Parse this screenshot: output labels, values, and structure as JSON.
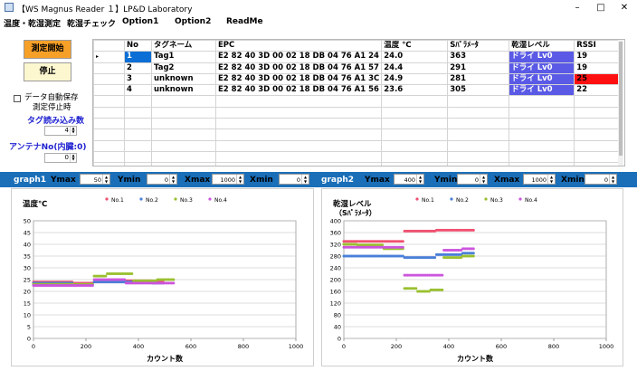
{
  "window": {
    "title": "【WS Magnus Reader １】LP&D Laboratory",
    "minimize": "–",
    "maximize": "□",
    "close": "✕"
  },
  "menu": [
    "温度・乾湿測定",
    "乾湿チェック",
    "Option1",
    "Option2",
    "ReadMe"
  ],
  "left": {
    "start_button": "測定開始",
    "stop_button": "停止",
    "auto_save_label": "データ自動保存",
    "auto_save_sub": "測定停止時",
    "tag_read_label": "タグ読み込み数",
    "tag_read_value": "4",
    "antenna_label": "アンテナNo(内臓:0)",
    "antenna_value": "0"
  },
  "table": {
    "headers": [
      "No",
      "タグネーム",
      "EPC",
      "温度 ℃",
      "Sﾊﾟﾗﾒｰﾀ",
      "乾湿レベル",
      "RSSI"
    ],
    "rows": [
      [
        "1",
        "Tag1",
        "E2 82 40 3D 00 02 18 DB 04 76 A1 24",
        "24.0",
        "363",
        "ドライ Lv0",
        "19"
      ],
      [
        "2",
        "Tag2",
        "E2 82 40 3D 00 02 18 DB 04 76 A1 57",
        "24.4",
        "291",
        "ドライ Lv0",
        "19"
      ],
      [
        "3",
        "unknown",
        "E2 82 40 3D 00 02 18 DB 04 76 A1 3C",
        "24.9",
        "281",
        "ドライ Lv0",
        "25"
      ],
      [
        "4",
        "unknown",
        "E2 82 40 3D 00 02 18 DB 04 76 A1 56",
        "23.6",
        "305",
        "ドライ Lv0",
        "22"
      ]
    ],
    "red_rssi_row": 2,
    "selected_no_row": 0,
    "empty_rows": 7
  },
  "graph1": {
    "label": "graph1",
    "ymax_label": "Ymax",
    "ymax": "50",
    "ymin_label": "Ymin",
    "ymin": "0",
    "xmax_label": "Xmax",
    "xmax": "1000",
    "xmin_label": "Xmin",
    "xmin": "0"
  },
  "graph2": {
    "label": "graph2",
    "ymax_label": "Ymax",
    "ymax": "400",
    "ymin_label": "Ymin",
    "ymin": "0",
    "xmax_label": "Xmax",
    "xmax": "1000",
    "xmin_label": "Xmin",
    "xmin": "0"
  },
  "chart_data": [
    {
      "type": "scatter",
      "title": "温度℃",
      "xlabel": "カウント数",
      "ylabel": "",
      "xlim": [
        0,
        1000
      ],
      "ylim": [
        0,
        50
      ],
      "xticks": [
        0,
        200,
        400,
        600,
        800,
        1000
      ],
      "yticks": [
        0,
        5,
        10,
        15,
        20,
        25,
        30,
        35,
        40,
        45,
        50
      ],
      "grid": true,
      "legend": "top",
      "series": [
        {
          "name": "No.1",
          "color": "#f05070",
          "points": [
            [
              0,
              24
            ],
            [
              100,
              24
            ],
            [
              200,
              23.5
            ],
            [
              250,
              24
            ],
            [
              300,
              24
            ],
            [
              400,
              24.5
            ],
            [
              500,
              24
            ]
          ]
        },
        {
          "name": "No.2",
          "color": "#4a7fd8",
          "points": [
            [
              0,
              23.5
            ],
            [
              100,
              23.5
            ],
            [
              200,
              23
            ],
            [
              250,
              24
            ],
            [
              300,
              24
            ],
            [
              400,
              24
            ],
            [
              500,
              23.5
            ]
          ]
        },
        {
          "name": "No.3",
          "color": "#9ac030",
          "points": [
            [
              0,
              23
            ],
            [
              100,
              23
            ],
            [
              200,
              23
            ],
            [
              250,
              26.5
            ],
            [
              300,
              27.5
            ],
            [
              350,
              27.5
            ],
            [
              400,
              24.5
            ],
            [
              540,
              25
            ]
          ]
        },
        {
          "name": "No.4",
          "color": "#cc55dd",
          "points": [
            [
              0,
              22.5
            ],
            [
              100,
              22.5
            ],
            [
              200,
              22.5
            ],
            [
              250,
              25
            ],
            [
              300,
              25
            ],
            [
              400,
              23.5
            ],
            [
              540,
              23.5
            ]
          ]
        }
      ]
    },
    {
      "type": "scatter",
      "title": "乾湿レベル",
      "subtitle": "（Sﾊﾟﾗﾒｰﾀ）",
      "xlabel": "カウント数",
      "ylabel": "",
      "xlim": [
        0,
        1000
      ],
      "ylim": [
        0,
        400
      ],
      "xticks": [
        0,
        200,
        400,
        600,
        800,
        1000
      ],
      "yticks": [
        0,
        40,
        80,
        120,
        160,
        200,
        240,
        280,
        320,
        360,
        400
      ],
      "grid": true,
      "legend": "top",
      "series": [
        {
          "name": "No.1",
          "color": "#f05070",
          "points": [
            [
              0,
              330
            ],
            [
              100,
              330
            ],
            [
              200,
              330
            ],
            [
              250,
              365
            ],
            [
              300,
              365
            ],
            [
              400,
              368
            ],
            [
              500,
              368
            ]
          ]
        },
        {
          "name": "No.2",
          "color": "#4a7fd8",
          "points": [
            [
              0,
              280
            ],
            [
              100,
              280
            ],
            [
              200,
              280
            ],
            [
              250,
              275
            ],
            [
              300,
              275
            ],
            [
              400,
              285
            ],
            [
              500,
              290
            ]
          ]
        },
        {
          "name": "No.3",
          "color": "#9ac030",
          "points": [
            [
              0,
              320
            ],
            [
              100,
              318
            ],
            [
              200,
              305
            ],
            [
              250,
              170
            ],
            [
              300,
              160
            ],
            [
              350,
              165
            ],
            [
              400,
              275
            ],
            [
              500,
              280
            ]
          ]
        },
        {
          "name": "No.4",
          "color": "#cc55dd",
          "points": [
            [
              0,
              310
            ],
            [
              100,
              310
            ],
            [
              200,
              310
            ],
            [
              250,
              215
            ],
            [
              300,
              215
            ],
            [
              350,
              215
            ],
            [
              400,
              300
            ],
            [
              500,
              305
            ]
          ]
        }
      ]
    }
  ]
}
